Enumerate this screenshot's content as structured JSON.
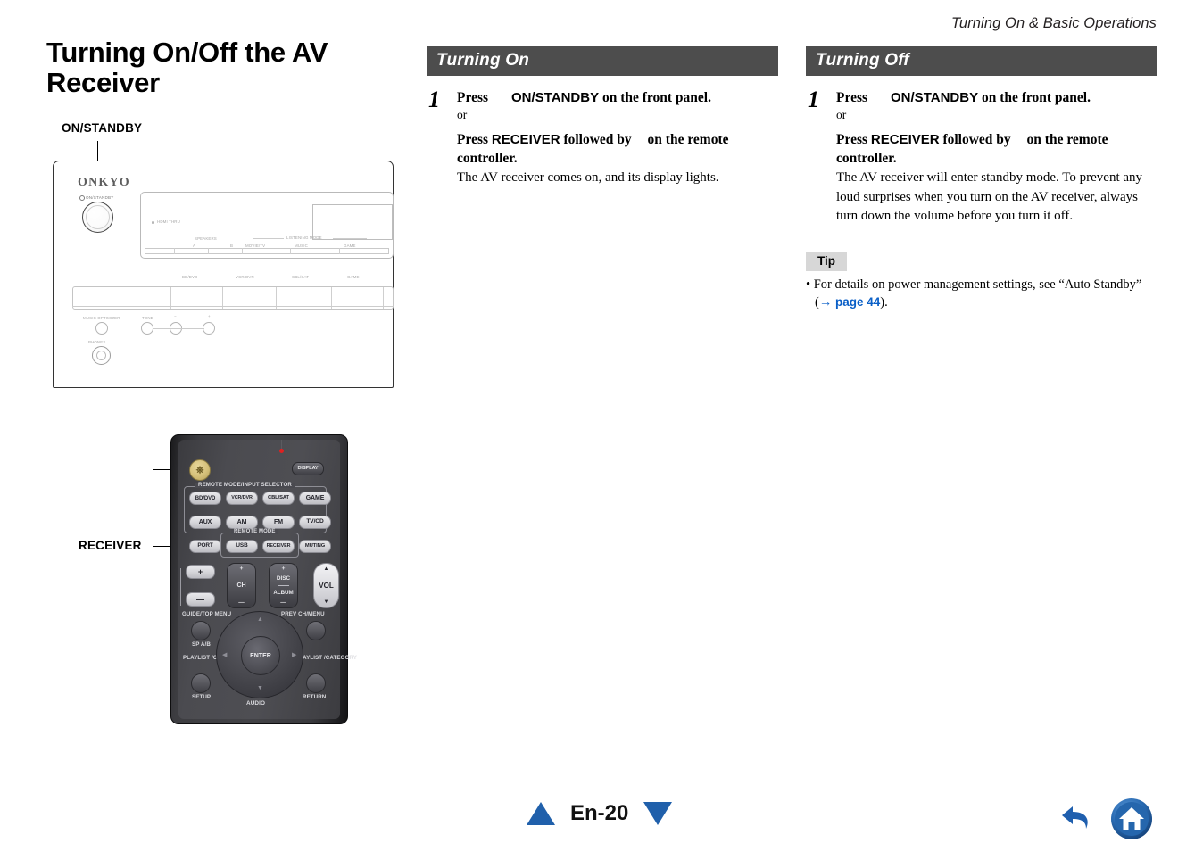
{
  "header": {
    "running_title": "Turning On & Basic Operations"
  },
  "left": {
    "heading": "Turning On/Off the AV Receiver",
    "callout_onstandby": "ON/STANDBY",
    "callout_receiver": "RECEIVER",
    "receiver_panel": {
      "brand": "ONKYO",
      "power_label": "ON/STANDBY",
      "display_indicator": "HDMI THRU",
      "speaker_label": "SPEAKERS",
      "speaker_a": "A",
      "speaker_b": "B",
      "listening_mode_label": "LISTENING MODE",
      "mode_movie": "MOVIE/TV",
      "mode_music": "MUSIC",
      "mode_game": "GAME",
      "inputs": [
        "BD/DVD",
        "VCR/DVR",
        "CBL/SAT",
        "GAME"
      ],
      "music_optimizer": "MUSIC OPTIMIZER",
      "tone": "TONE",
      "minus": "−",
      "plus": "+",
      "phones": "PHONES"
    },
    "remote": {
      "display_btn": "DISPLAY",
      "group_input_selector": "REMOTE MODE/INPUT SELECTOR",
      "group_remote_mode": "REMOTE MODE",
      "buttons_row1": [
        "BD/DVD",
        "VCR/DVR",
        "CBL/SAT",
        "GAME"
      ],
      "buttons_row2": [
        "AUX",
        "AM",
        "FM",
        "TV/CD"
      ],
      "buttons_row3": [
        "PORT",
        "USB",
        "RECEIVER",
        "MUTING"
      ],
      "vol_label": "VOL",
      "vol_up": "▲",
      "vol_down": "▼",
      "ch_label": "CH",
      "disc_label": "DISC",
      "album_label": "ALBUM",
      "plus": "+",
      "minus": "—",
      "guide_top_menu": "GUIDE/TOP MENU",
      "prev_ch_menu": "PREV CH/MENU",
      "sp_ab": "SP A/B",
      "playlist_category_left": "PLAYLIST /CATEGORY",
      "playlist_category_right": "PLAYLIST /CATEGORY",
      "enter": "ENTER",
      "setup": "SETUP",
      "audio": "AUDIO",
      "return": "RETURN"
    }
  },
  "mid": {
    "section_title": "Turning On",
    "step_number": "1",
    "head_press": "Press",
    "head_button": "ON/STANDBY",
    "head_tail": "on the front panel.",
    "or": "or",
    "alt_press": "Press",
    "alt_button": "RECEIVER",
    "alt_mid": "followed by",
    "alt_tail": "on the remote controller.",
    "result": "The AV receiver comes on, and its display lights."
  },
  "right": {
    "section_title": "Turning Off",
    "step_number": "1",
    "head_press": "Press",
    "head_button": "ON/STANDBY",
    "head_tail": "on the front panel.",
    "or": "or",
    "alt_press": "Press",
    "alt_button": "RECEIVER",
    "alt_mid": "followed by",
    "alt_tail": "on the remote controller.",
    "result": "The AV receiver will enter standby mode. To prevent any loud surprises when you turn on the AV receiver, always turn down the volume before you turn it off.",
    "tip_label": "Tip",
    "tip_bullet_pre": "• For details on power management settings, see “Auto Standby” (",
    "tip_arrow": "→",
    "tip_link": "page 44",
    "tip_bullet_post": ")."
  },
  "footer": {
    "page_label": "En-20",
    "prev_arrow": "up-triangle",
    "next_arrow": "down-triangle",
    "back_icon": "back-arrow-icon",
    "home_icon": "home-icon",
    "accent_color": "#2060ab"
  }
}
